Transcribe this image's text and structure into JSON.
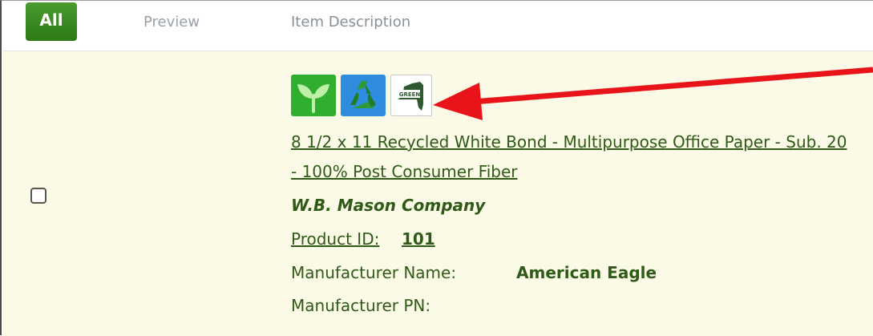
{
  "header": {
    "all_button": "All",
    "col_preview": "Preview",
    "col_description": "Item Description"
  },
  "item": {
    "badges": [
      {
        "icon": "green-leaf-icon",
        "color": "#2fae2f"
      },
      {
        "icon": "recycle-icon",
        "color": "#2f8de0"
      },
      {
        "icon": "ny-green-state-icon",
        "label": "GREEN"
      }
    ],
    "title": "8 1/2 x 11 Recycled White Bond - Multipurpose Office Paper - Sub. 20 - 100% Post Consumer Fiber",
    "company": "W.B. Mason Company",
    "product_id_label": "Product ID:",
    "product_id": "101",
    "manufacturer_name_label": "Manufacturer Name:",
    "manufacturer_name": "American Eagle",
    "manufacturer_pn_label": "Manufacturer PN:",
    "selected": false
  },
  "annotation": {
    "arrow_color": "#e8141a"
  }
}
